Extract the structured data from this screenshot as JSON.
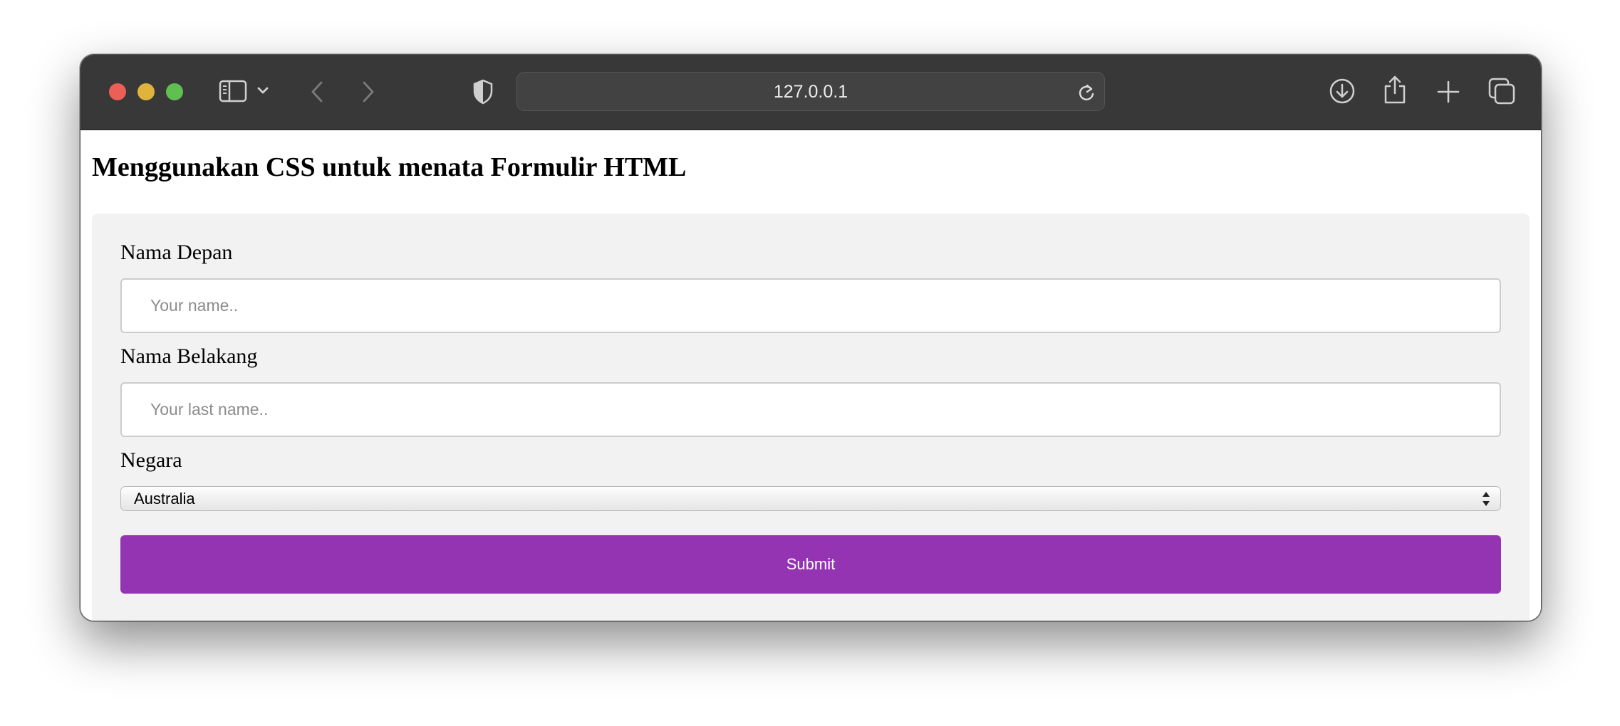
{
  "browser": {
    "url": "127.0.0.1",
    "toolbar_icons": [
      "sidebar-icon",
      "chevron-down-icon",
      "back-arrow-icon",
      "forward-arrow-icon",
      "shield-icon",
      "reload-icon",
      "download-icon",
      "share-icon",
      "plus-icon",
      "tabs-icon"
    ]
  },
  "page": {
    "title": "Menggunakan CSS untuk menata Formulir HTML"
  },
  "form": {
    "first_name": {
      "label": "Nama Depan",
      "placeholder": "Your name..",
      "value": ""
    },
    "last_name": {
      "label": "Nama Belakang",
      "placeholder": "Your last name..",
      "value": ""
    },
    "country": {
      "label": "Negara",
      "selected": "Australia"
    },
    "submit_label": "Submit"
  },
  "colors": {
    "submit_background": "#9534b2",
    "form_background": "#f2f2f2",
    "titlebar": "#383838"
  }
}
